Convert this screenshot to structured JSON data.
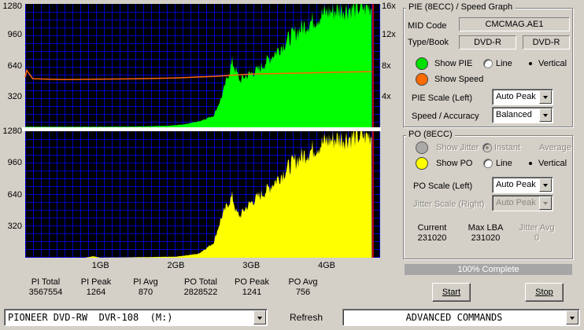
{
  "pie_chart": {
    "left_ticks": [
      "1280",
      "960",
      "640",
      "320"
    ],
    "right_ticks": [
      "16x",
      "12x",
      "8x",
      "4x"
    ]
  },
  "po_chart": {
    "left_ticks": [
      "1280",
      "960",
      "640",
      "320"
    ],
    "x_ticks": [
      "1GB",
      "2GB",
      "3GB",
      "4GB"
    ]
  },
  "chart_data": [
    {
      "type": "area",
      "x_unit": "GB",
      "xlim": [
        0,
        4.7
      ],
      "ylim": [
        0,
        1280
      ],
      "y_ticks": [
        320,
        640,
        960,
        1280
      ],
      "y2lim": [
        0,
        16
      ],
      "y2_ticks": [
        "4x",
        "8x",
        "12x",
        "16x"
      ],
      "grid": true,
      "series": [
        {
          "label": "PIE",
          "color": "#00ff00",
          "x": [
            0.0,
            0.5,
            1.0,
            1.5,
            1.9,
            2.1,
            2.3,
            2.5,
            2.6,
            2.7,
            2.75,
            2.8,
            2.85,
            2.9,
            3.0,
            3.1,
            3.2,
            3.3,
            3.4,
            3.5,
            3.6,
            3.7,
            3.8,
            3.9,
            4.0,
            4.1,
            4.2,
            4.3,
            4.4,
            4.5,
            4.6
          ],
          "y": [
            5,
            5,
            5,
            8,
            15,
            30,
            60,
            120,
            300,
            560,
            680,
            580,
            480,
            520,
            560,
            600,
            680,
            760,
            840,
            920,
            990,
            1050,
            1100,
            1150,
            1190,
            1210,
            1225,
            1235,
            1240,
            1245,
            1250
          ]
        },
        {
          "label": "Speed",
          "color": "#ff6600",
          "x": [
            0.0,
            0.02,
            0.1,
            0.5,
            1.0,
            1.5,
            2.0,
            2.5,
            3.0,
            3.5,
            4.0,
            4.5,
            4.6
          ],
          "y": [
            6.5,
            7.4,
            6.3,
            6.2,
            6.25,
            6.3,
            6.4,
            6.6,
            6.9,
            7.0,
            7.1,
            7.2,
            7.2
          ]
        }
      ]
    },
    {
      "type": "area",
      "x_unit": "GB",
      "xlim": [
        0,
        4.7
      ],
      "ylim": [
        0,
        1280
      ],
      "x_ticks": [
        "1GB",
        "2GB",
        "3GB",
        "4GB"
      ],
      "y_ticks": [
        320,
        640,
        960,
        1280
      ],
      "grid": true,
      "series": [
        {
          "label": "PO",
          "color": "#ffff00",
          "x": [
            0.0,
            0.8,
            0.9,
            1.0,
            1.5,
            2.0,
            2.3,
            2.5,
            2.6,
            2.7,
            2.75,
            2.8,
            2.85,
            2.9,
            3.0,
            3.1,
            3.2,
            3.3,
            3.4,
            3.5,
            3.6,
            3.7,
            3.8,
            3.9,
            4.0,
            4.1,
            4.2,
            4.3,
            4.4,
            4.5,
            4.6
          ],
          "y": [
            0,
            0,
            15,
            0,
            5,
            10,
            40,
            150,
            400,
            560,
            620,
            460,
            420,
            480,
            560,
            620,
            680,
            760,
            840,
            920,
            990,
            1040,
            1090,
            1140,
            1180,
            1200,
            1210,
            1220,
            1230,
            1235,
            1241
          ]
        }
      ]
    }
  ],
  "stats": [
    {
      "label": "PI Total",
      "value": "3567554"
    },
    {
      "label": "PI Peak",
      "value": "1264"
    },
    {
      "label": "PI Avg",
      "value": "870"
    },
    {
      "label": "PO Total",
      "value": "2828522"
    },
    {
      "label": "PO Peak",
      "value": "1241"
    },
    {
      "label": "PO Avg",
      "value": "756"
    }
  ],
  "pie_panel": {
    "title": "PIE (8ECC) / Speed Graph",
    "mid_code_label": "MID Code",
    "mid_code_value": "CMCMAG.AE1",
    "type_book_label": "Type/Book",
    "type_value": "DVD-R",
    "book_value": "DVD-R",
    "show_pie_label": "Show PIE",
    "line_label": "Line",
    "vertical_label": "Vertical",
    "show_speed_label": "Show Speed",
    "pie_scale_label": "PIE Scale (Left)",
    "pie_scale_value": "Auto Peak",
    "speed_accuracy_label": "Speed / Accuracy",
    "speed_accuracy_value": "Balanced",
    "pie_color": "#00e000",
    "speed_color": "#ff6a00"
  },
  "po_panel": {
    "title": "PO (8ECC)",
    "show_jitter_label": "Show Jitter",
    "instant_label": "Instant",
    "average_label": "Average",
    "show_po_label": "Show PO",
    "line_label": "Line",
    "vertical_label": "Vertical",
    "po_scale_label": "PO Scale (Left)",
    "po_scale_value": "Auto Peak",
    "jitter_scale_label": "Jitter Scale (Right)",
    "jitter_scale_value": "Auto Peak",
    "current_label": "Current",
    "current_value": "231020",
    "max_lba_label": "Max LBA",
    "max_lba_value": "231020",
    "jitter_avg_label": "Jitter Avg",
    "jitter_avg_value": "0",
    "po_color": "#ffff00",
    "jitter_color": "#a0a0a0"
  },
  "progress": {
    "text": "100% Complete",
    "value": 1.0
  },
  "buttons": {
    "start_label": "Start",
    "stop_label": "Stop",
    "refresh_label": "Refresh"
  },
  "bottom": {
    "drive_value": "PIONEER DVD-RW  DVR-108  (M:)",
    "commands_value": "ADVANCED COMMANDS"
  }
}
